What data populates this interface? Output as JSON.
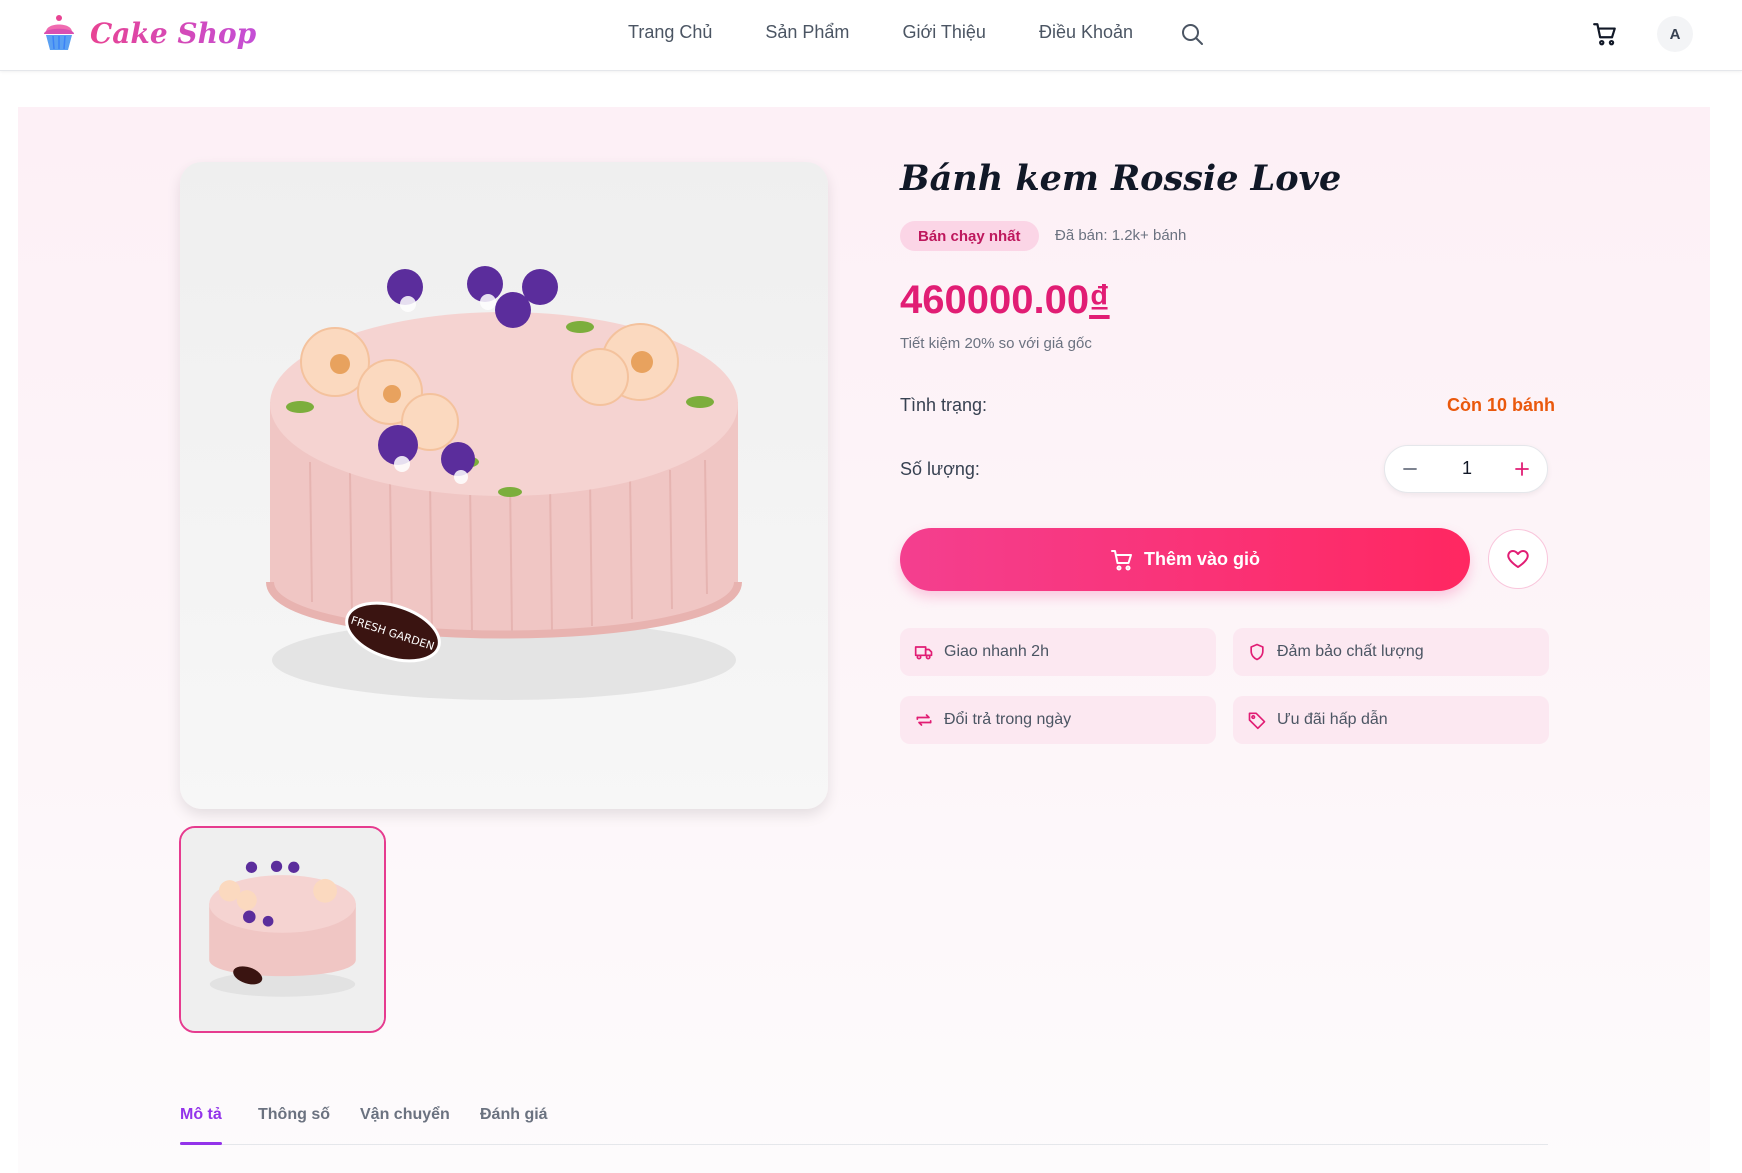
{
  "header": {
    "brand": "Cake Shop",
    "nav": [
      "Trang Chủ",
      "Sản Phẩm",
      "Giới Thiệu",
      "Điều Khoản"
    ],
    "avatar_initial": "A",
    "icons": [
      "cupcake-logo-icon",
      "search-icon",
      "cart-icon"
    ]
  },
  "product": {
    "title": "Bánh kem Rossie Love",
    "badge": "Bán chạy nhất",
    "sold": "Đã bán: 1.2k+ bánh",
    "price": "460000.00",
    "currency": "₫",
    "savings": "Tiết kiệm 20% so với giá gốc",
    "status_label": "Tình trạng:",
    "status_value": "Còn 10 bánh",
    "quantity_label": "Số lượng:",
    "quantity": "1",
    "add_to_cart": "Thêm vào giỏ",
    "plaque_text": "FRESH GARDEN"
  },
  "features": [
    {
      "icon": "truck-icon",
      "label": "Giao nhanh 2h"
    },
    {
      "icon": "shield-icon",
      "label": "Đảm bảo chất lượng"
    },
    {
      "icon": "exchange-icon",
      "label": "Đổi trả trong ngày"
    },
    {
      "icon": "tag-icon",
      "label": "Ưu đãi hấp dẫn"
    }
  ],
  "tabs": [
    "Mô tả",
    "Thông số",
    "Vận chuyển",
    "Đánh giá"
  ],
  "colors": {
    "accent": "#e11d74",
    "brand_gradient": [
      "#e84393",
      "#c44fd6"
    ],
    "button_gradient": [
      "#f43f8f",
      "#ff2761"
    ],
    "status": "#ea580c",
    "tab_active": "#9333ea"
  }
}
